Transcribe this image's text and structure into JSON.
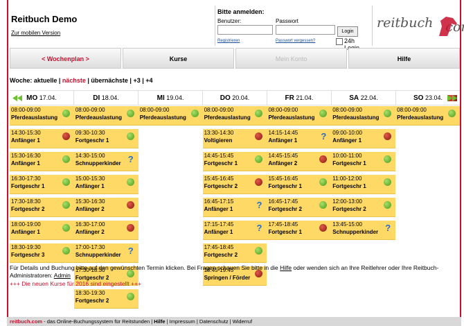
{
  "header": {
    "title": "Reitbuch Demo",
    "mobile_link": "Zur mobilen Version"
  },
  "login": {
    "title": "Bitte anmelden:",
    "user_label": "Benutzer:",
    "pass_label": "Passwort",
    "button": "Login",
    "register": "Registrieren",
    "forgot": "Passwort vergessen?",
    "remember": "24h Login"
  },
  "logo": {
    "text": "reitbuch",
    "suffix": "com"
  },
  "nav": {
    "items": [
      "< Wochenplan >",
      "Kurse",
      "Mein Konto",
      "Hilfe"
    ]
  },
  "week": {
    "prefix": "Woche: aktuelle | ",
    "next": "nächste",
    "rest": " | übernächste | +3 | +4"
  },
  "days": [
    {
      "name": "MO",
      "date": "17.04."
    },
    {
      "name": "DI",
      "date": "18.04."
    },
    {
      "name": "MI",
      "date": "19.04."
    },
    {
      "name": "DO",
      "date": "20.04."
    },
    {
      "name": "FR",
      "date": "21.04."
    },
    {
      "name": "SA",
      "date": "22.04."
    },
    {
      "name": "SO",
      "date": "23.04."
    }
  ],
  "columns": [
    [
      {
        "time": "08:00-09:00",
        "name": "Pferdeauslastung",
        "status": "green"
      },
      {
        "time": "14:30-15:30",
        "name": "Anfänger 1",
        "status": "red"
      },
      {
        "time": "15:30-16:30",
        "name": "Anfänger 1",
        "status": "green"
      },
      {
        "time": "16:30-17:30",
        "name": "Fortgeschr 1",
        "status": "green"
      },
      {
        "time": "17:30-18:30",
        "name": "Fortgeschr 2",
        "status": "green"
      },
      {
        "time": "18:00-19:00",
        "name": "Anfänger 1",
        "status": "green"
      },
      {
        "time": "18:30-19:30",
        "name": "Fortgeschr 3",
        "status": "green"
      }
    ],
    [
      {
        "time": "08:00-09:00",
        "name": "Pferdeauslastung",
        "status": "green"
      },
      {
        "time": "09:30-10:30",
        "name": "Fortgeschr 1",
        "status": "green"
      },
      {
        "time": "14:30-15:00",
        "name": "Schnupperkinder",
        "status": "unknown"
      },
      {
        "time": "15:00-15:30",
        "name": "Anfänger 1",
        "status": "green"
      },
      {
        "time": "15:30-16:30",
        "name": "Anfänger 2",
        "status": "red"
      },
      {
        "time": "16:30-17:00",
        "name": "Anfänger 2",
        "status": "red"
      },
      {
        "time": "17:00-17:30",
        "name": "Schnupperkinder",
        "status": "unknown"
      },
      {
        "time": "17:30-18:30",
        "name": "Fortgeschr 2",
        "status": "green"
      },
      {
        "time": "18:30-19:30",
        "name": "Fortgeschr 2",
        "status": "green"
      }
    ],
    [
      {
        "time": "08:00-09:00",
        "name": "Pferdeauslastung",
        "status": "green"
      }
    ],
    [
      {
        "time": "08:00-09:00",
        "name": "Pferdeauslastung",
        "status": "green"
      },
      {
        "time": "13:30-14:30",
        "name": "Voltigieren",
        "status": "red"
      },
      {
        "time": "14:45-15:45",
        "name": "Fortgeschr 1",
        "status": "green"
      },
      {
        "time": "15:45-16:45",
        "name": "Fortgeschr 2",
        "status": "red"
      },
      {
        "time": "16:45-17:15",
        "name": "Anfänger 1",
        "status": "unknown"
      },
      {
        "time": "17:15-17:45",
        "name": "Anfänger 1",
        "status": "unknown"
      },
      {
        "time": "17:45-18:45",
        "name": "Fortgeschr 2",
        "status": "green"
      },
      {
        "time": "18:45-19:45",
        "name": "Springen / Förder",
        "status": "red"
      }
    ],
    [
      {
        "time": "08:00-09:00",
        "name": "Pferdeauslastung",
        "status": "green"
      },
      {
        "time": "14:15-14:45",
        "name": "Anfänger 1",
        "status": "unknown"
      },
      {
        "time": "14:45-15:45",
        "name": "Anfänger 2",
        "status": "red"
      },
      {
        "time": "15:45-16:45",
        "name": "Fortgeschr 1",
        "status": "green"
      },
      {
        "time": "16:45-17:45",
        "name": "Fortgeschr 2",
        "status": "green"
      },
      {
        "time": "17:45-18:45",
        "name": "Fortgeschr 1",
        "status": "red"
      }
    ],
    [
      {
        "time": "08:00-09:00",
        "name": "Pferdeauslastung",
        "status": "green"
      },
      {
        "time": "09:00-10:00",
        "name": "Anfänger 1",
        "status": "red"
      },
      {
        "time": "10:00-11:00",
        "name": "Fortgeschr 1",
        "status": "green"
      },
      {
        "time": "11:00-12:00",
        "name": "Fortgeschr 1",
        "status": "green"
      },
      {
        "time": "12:00-13:00",
        "name": "Fortgeschr 2",
        "status": "green"
      },
      {
        "time": "13:45-15:00",
        "name": "Schnupperkinder",
        "status": "unknown"
      }
    ],
    [
      {
        "time": "08:00-09:00",
        "name": "Pferdeauslastung",
        "status": "green"
      }
    ]
  ],
  "info": {
    "text1": "Für Details und Buchung bitte auf den gewünschten Termin klicken. Bei Fragen schauen Sie bitte in die ",
    "help": "Hilfe",
    "text2": " oder wenden sich an Ihre Reitlehrer oder Ihre Reitbuch-Administratoren: ",
    "admin": "Admin"
  },
  "news": "+++ Die neuen Kurse für 2016 sind eingestellt +++",
  "footer": {
    "brand": "reitbuch.com",
    "tagline": " - das Online-Buchungssystem für Reitstunden | ",
    "help": "Hilfe",
    "rest": " | Impressum | Datenschutz | Widerruf"
  },
  "colors": {
    "accent": "#c8102e",
    "slot": "#ffd966",
    "green": "#4c9a1a",
    "red": "#8c1a10",
    "question": "#2a6bc4"
  }
}
